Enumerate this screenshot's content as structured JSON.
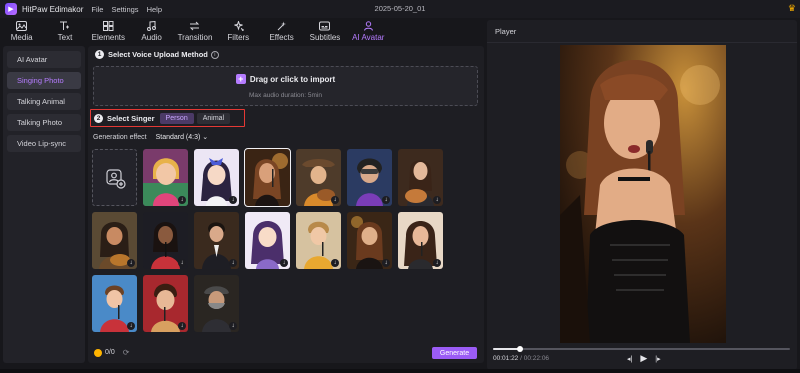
{
  "app": {
    "name": "HitPaw Edimakor",
    "menu": [
      "File",
      "Settings",
      "Help"
    ],
    "document_title": "2025-05-20_01"
  },
  "toolbar": {
    "items": [
      {
        "label": "Media",
        "icon": "media-icon"
      },
      {
        "label": "Text",
        "icon": "text-icon"
      },
      {
        "label": "Elements",
        "icon": "elements-icon"
      },
      {
        "label": "Audio",
        "icon": "audio-icon"
      },
      {
        "label": "Transition",
        "icon": "transition-icon"
      },
      {
        "label": "Filters",
        "icon": "filters-icon"
      },
      {
        "label": "Effects",
        "icon": "effects-icon"
      },
      {
        "label": "Subtitles",
        "icon": "subtitles-icon"
      },
      {
        "label": "AI Avatar",
        "icon": "ai-avatar-icon",
        "active": true
      }
    ]
  },
  "sidebar": {
    "items": [
      {
        "label": "AI Avatar"
      },
      {
        "label": "Singing Photo",
        "active": true
      },
      {
        "label": "Talking Animal"
      },
      {
        "label": "Talking Photo"
      },
      {
        "label": "Video Lip-sync"
      }
    ]
  },
  "step1": {
    "number": "1",
    "title": "Select Voice Upload Method",
    "drop_label": "Drag or click to import",
    "drop_hint": "Max audio duration: 5min"
  },
  "step2": {
    "number": "2",
    "title": "Select Singer",
    "tabs": [
      {
        "label": "Person",
        "active": true
      },
      {
        "label": "Animal"
      }
    ]
  },
  "generation": {
    "label": "Generation effect",
    "value": "Standard (4:3)"
  },
  "footer": {
    "credits": "0/0",
    "generate_label": "Generate"
  },
  "player": {
    "title": "Player",
    "current_time": "00:01:22",
    "separator": "/",
    "total_time": "00:22:06",
    "progress": 0.09
  },
  "colors": {
    "accent": "#9b5cf6",
    "accent_text": "#b57cff",
    "highlight_border": "#e53935",
    "background": "#17171b"
  }
}
